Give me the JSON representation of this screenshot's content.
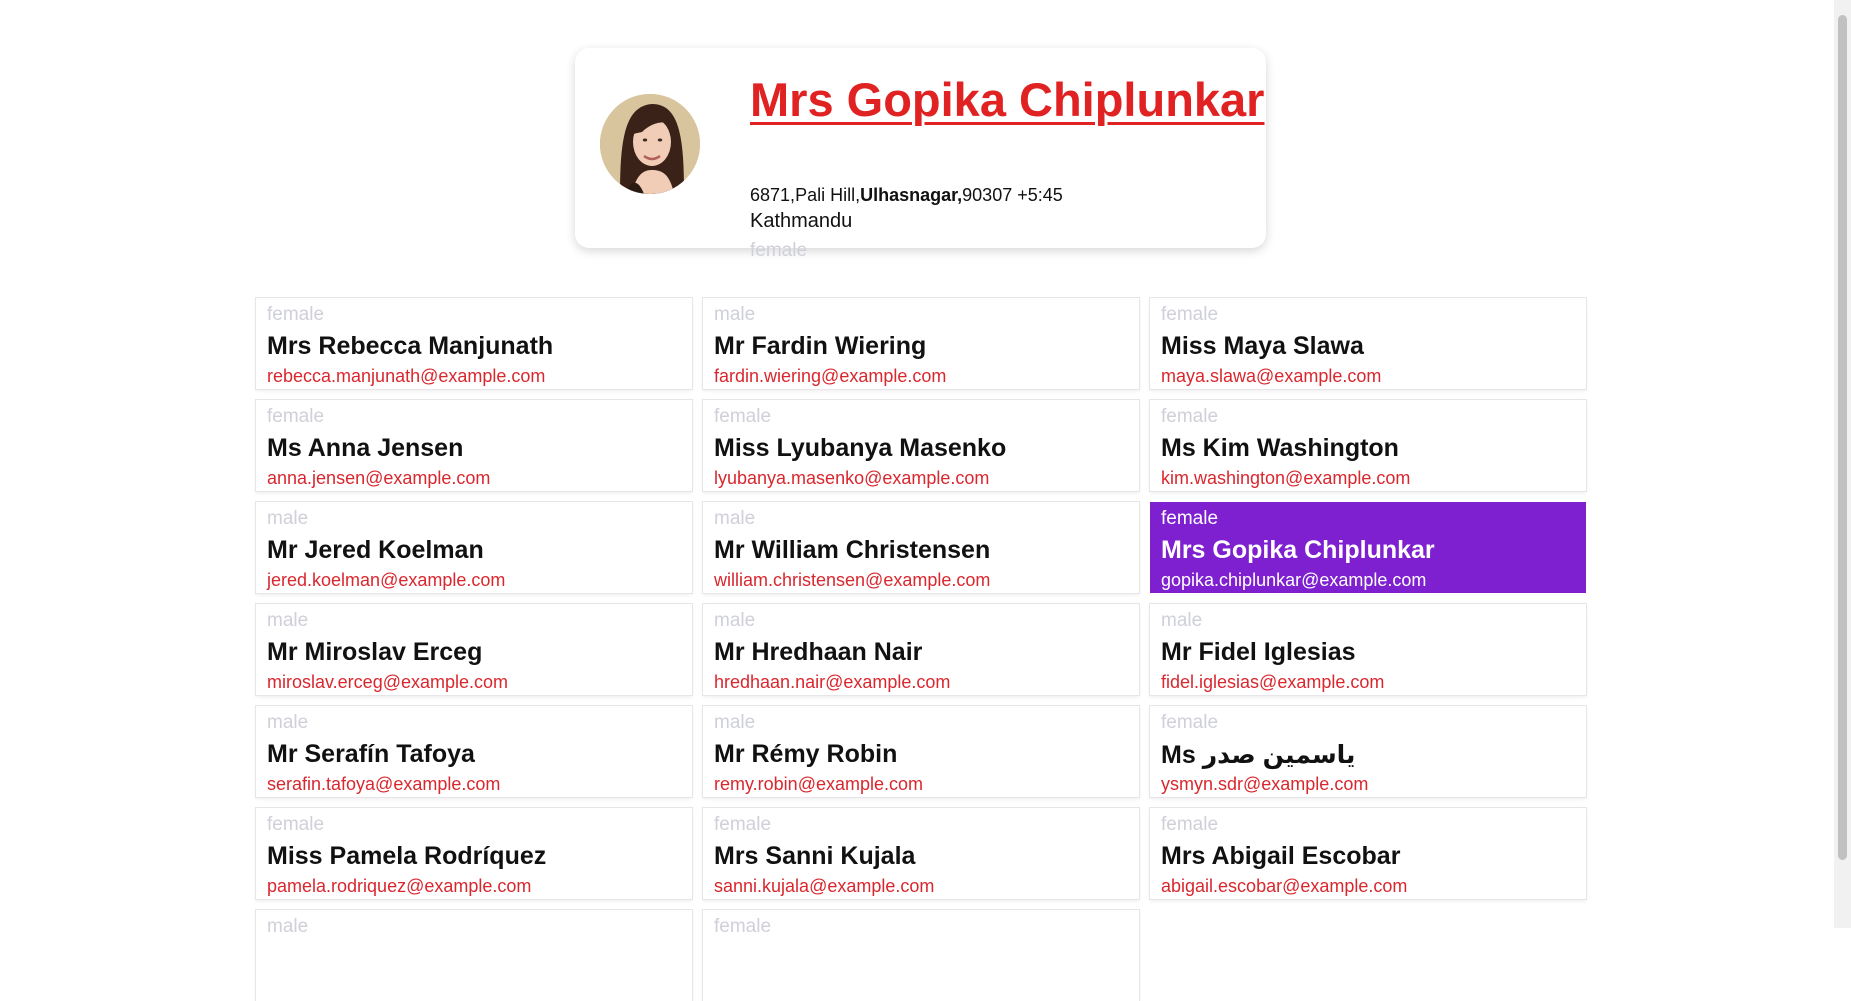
{
  "profile": {
    "name": "Mrs Gopika Chiplunkar",
    "address": {
      "number": "6871",
      "street": "Pali Hill",
      "city": "Ulhasnagar",
      "postcode": "90307",
      "offset": "+5:45"
    },
    "timezone_description": "Kathmandu",
    "gender": "female"
  },
  "users": [
    {
      "gender": "female",
      "name": "Mrs Rebecca Manjunath",
      "email": "rebecca.manjunath@example.com"
    },
    {
      "gender": "male",
      "name": "Mr Fardin Wiering",
      "email": "fardin.wiering@example.com"
    },
    {
      "gender": "female",
      "name": "Miss Maya Slawa",
      "email": "maya.slawa@example.com"
    },
    {
      "gender": "female",
      "name": "Ms Anna Jensen",
      "email": "anna.jensen@example.com"
    },
    {
      "gender": "female",
      "name": "Miss Lyubanya Masenko",
      "email": "lyubanya.masenko@example.com"
    },
    {
      "gender": "female",
      "name": "Ms Kim Washington",
      "email": "kim.washington@example.com"
    },
    {
      "gender": "male",
      "name": "Mr Jered Koelman",
      "email": "jered.koelman@example.com"
    },
    {
      "gender": "male",
      "name": "Mr William Christensen",
      "email": "william.christensen@example.com"
    },
    {
      "gender": "female",
      "name": "Mrs Gopika Chiplunkar",
      "email": "gopika.chiplunkar@example.com",
      "selected": true
    },
    {
      "gender": "male",
      "name": "Mr Miroslav Erceg",
      "email": "miroslav.erceg@example.com"
    },
    {
      "gender": "male",
      "name": "Mr Hredhaan Nair",
      "email": "hredhaan.nair@example.com"
    },
    {
      "gender": "male",
      "name": "Mr Fidel Iglesias",
      "email": "fidel.iglesias@example.com"
    },
    {
      "gender": "male",
      "name": "Mr Serafín Tafoya",
      "email": "serafin.tafoya@example.com"
    },
    {
      "gender": "male",
      "name": "Mr Rémy Robin",
      "email": "remy.robin@example.com"
    },
    {
      "gender": "female",
      "name": "Ms ياسمين صدر",
      "email": "ysmyn.sdr@example.com"
    },
    {
      "gender": "female",
      "name": "Miss Pamela Rodríquez",
      "email": "pamela.rodriquez@example.com"
    },
    {
      "gender": "female",
      "name": "Mrs Sanni Kujala",
      "email": "sanni.kujala@example.com"
    },
    {
      "gender": "female",
      "name": "Mrs Abigail Escobar",
      "email": "abigail.escobar@example.com"
    },
    {
      "gender": "male",
      "name": "",
      "email": ""
    },
    {
      "gender": "female",
      "name": "",
      "email": ""
    }
  ],
  "colors": {
    "accent_link": "#e02222",
    "selected_bg": "#7e1fd0",
    "muted": "#cfd0d8"
  }
}
